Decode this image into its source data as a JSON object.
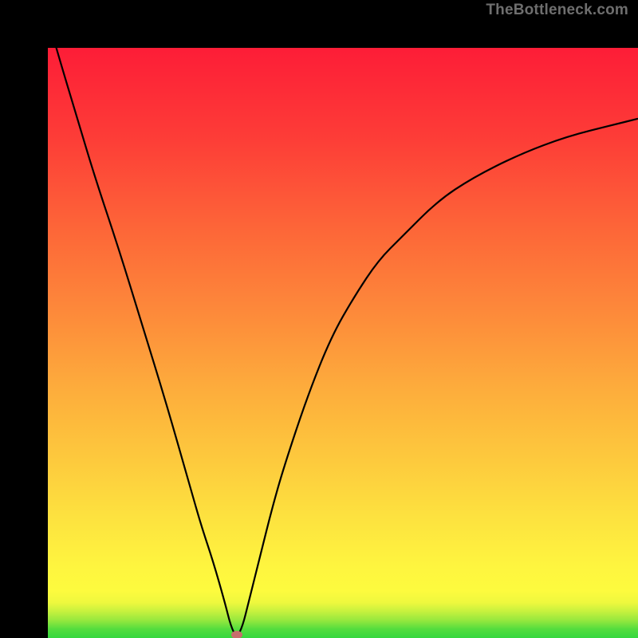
{
  "watermark": "TheBottleneck.com",
  "colors": {
    "frame": "#000000",
    "curve": "#000000",
    "marker": "#c76d6d",
    "gradient_top": "#fd1d37",
    "gradient_bottom": "#35d73f"
  },
  "chart_data": {
    "type": "line",
    "title": "",
    "xlabel": "",
    "ylabel": "",
    "xlim": [
      0,
      100
    ],
    "ylim": [
      0,
      100
    ],
    "grid": false,
    "series": [
      {
        "name": "bottleneck-curve",
        "x": [
          0,
          2,
          5,
          8,
          12,
          16,
          20,
          24,
          26,
          28,
          30,
          31,
          32,
          33,
          34,
          36,
          38,
          40,
          44,
          48,
          52,
          56,
          60,
          66,
          72,
          80,
          88,
          96,
          100
        ],
        "y": [
          105,
          98,
          88,
          78,
          66,
          53,
          40,
          26,
          19,
          13,
          6,
          2,
          0,
          2,
          6,
          14,
          22,
          29,
          41,
          51,
          58,
          64,
          68,
          74,
          78,
          82,
          85,
          87,
          88
        ]
      }
    ],
    "annotations": [
      {
        "name": "minimum-marker",
        "x": 32,
        "y": 0.5
      }
    ]
  }
}
